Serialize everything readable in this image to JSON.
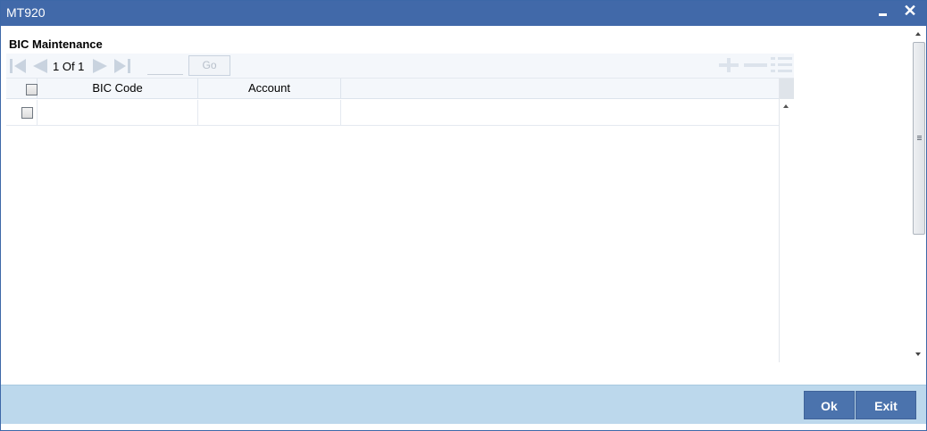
{
  "window": {
    "title": "MT920",
    "minimize_icon": "minimize-icon",
    "close_icon": "close-icon",
    "close_glyph": "✕"
  },
  "section": {
    "title": "BIC Maintenance"
  },
  "pagination": {
    "current_text": "1 Of 1",
    "page_input_value": "",
    "go_label": "Go",
    "icons": [
      "first-page-icon",
      "previous-page-icon",
      "next-page-icon",
      "last-page-icon"
    ]
  },
  "grid_tools": {
    "icons": [
      "add-row-icon",
      "delete-row-icon",
      "single-view-icon"
    ]
  },
  "grid": {
    "columns": [
      "BIC Code",
      "Account"
    ],
    "rows": [
      {
        "checked": false,
        "bic_code": "",
        "account": ""
      }
    ]
  },
  "footer": {
    "ok_label": "Ok",
    "exit_label": "Exit"
  },
  "colors": {
    "titlebar": "#4169a9",
    "footer": "#bcd8ec",
    "button": "#4b73ad"
  }
}
